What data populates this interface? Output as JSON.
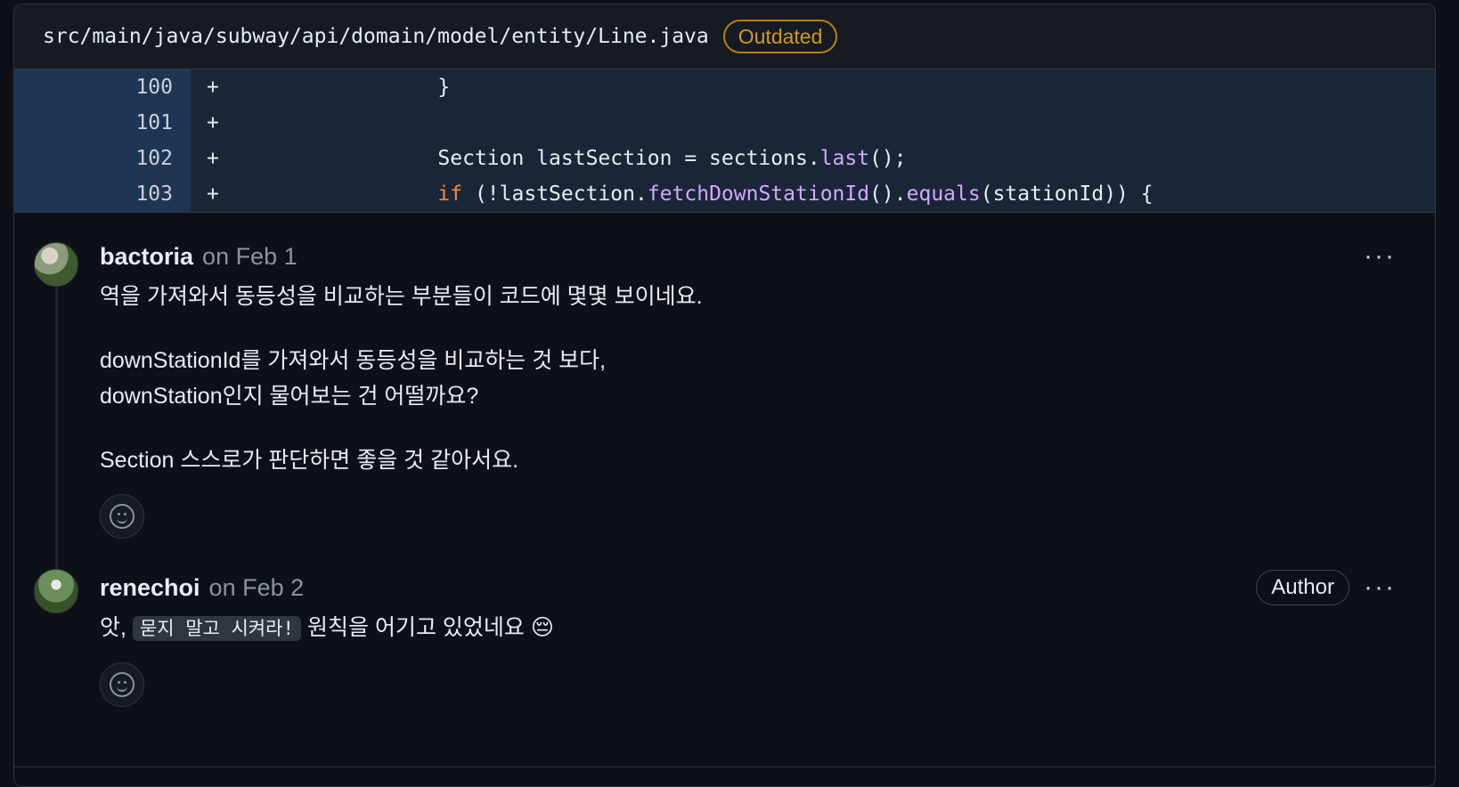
{
  "file": {
    "path": "src/main/java/subway/api/domain/model/entity/Line.java",
    "status_badge": "Outdated"
  },
  "diff": {
    "lines": [
      {
        "num": "100",
        "marker": "+",
        "code": "                 }"
      },
      {
        "num": "101",
        "marker": "+",
        "code": ""
      },
      {
        "num": "102",
        "marker": "+",
        "code": "                 Section lastSection = sections.",
        "fn": "last",
        "tail": "();"
      },
      {
        "num": "103",
        "marker": "+",
        "code": "                 ",
        "kw": "if",
        "mid1": " (!lastSection.",
        "fn1": "fetchDownStationId",
        "mid2": "().",
        "fn2": "equals",
        "tail": "(stationId)) {"
      }
    ]
  },
  "comments": [
    {
      "author": "bactoria",
      "date": "on Feb 1",
      "menu": "···",
      "paragraphs": [
        "역을 가져와서 동등성을 비교하는 부분들이 코드에 몇몇 보이네요.",
        "downStationId를 가져와서 동등성을 비교하는 것 보다,",
        "downStation인지 물어보는 건 어떨까요?",
        "Section 스스로가 판단하면 좋을 것 같아서요."
      ]
    },
    {
      "author": "renechoi",
      "date": "on Feb 2",
      "author_badge": "Author",
      "menu": "···",
      "text_before": "앗, ",
      "inline_code": "묻지 말고 시켜라!",
      "text_after": " 원칙을 어기고 있었네요 😔"
    }
  ]
}
